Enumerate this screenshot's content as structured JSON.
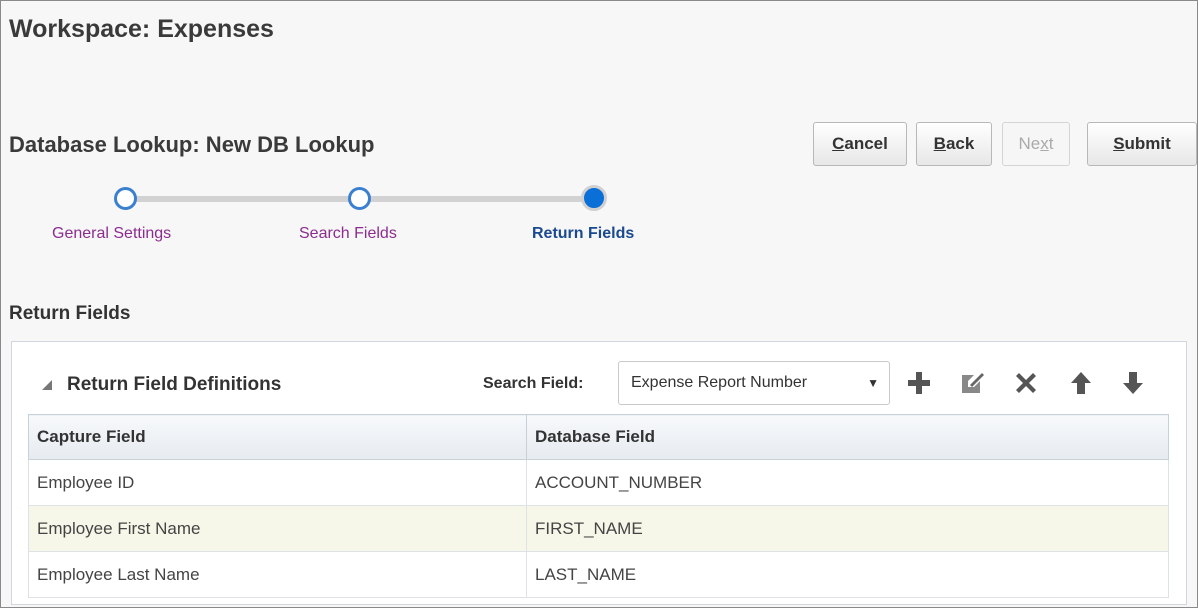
{
  "workspace_title": "Workspace: Expenses",
  "lookup_title": "Database Lookup: New DB Lookup",
  "buttons": {
    "cancel": {
      "pre": "",
      "mnemonic": "C",
      "post": "ancel"
    },
    "back": {
      "pre": "",
      "mnemonic": "B",
      "post": "ack"
    },
    "next": {
      "pre": "Ne",
      "mnemonic": "x",
      "post": "t"
    },
    "submit": {
      "pre": "",
      "mnemonic": "S",
      "post": "ubmit"
    }
  },
  "train": {
    "steps": [
      {
        "label": "General Settings",
        "state": "visited"
      },
      {
        "label": "Search Fields",
        "state": "visited"
      },
      {
        "label": "Return Fields",
        "state": "current"
      }
    ]
  },
  "section_title": "Return Fields",
  "panel": {
    "title": "Return Field Definitions",
    "search_label": "Search Field:",
    "search_value": "Expense Report Number",
    "toolbar_icons": [
      "add-icon",
      "edit-icon",
      "delete-icon",
      "move-up-icon",
      "move-down-icon"
    ]
  },
  "table": {
    "columns": [
      "Capture Field",
      "Database Field"
    ],
    "rows": [
      [
        "Employee ID",
        "ACCOUNT_NUMBER"
      ],
      [
        "Employee First Name",
        "FIRST_NAME"
      ],
      [
        "Employee Last Name",
        "LAST_NAME"
      ]
    ]
  },
  "colors": {
    "accent": "#0a6fd6",
    "visited_label": "#8b2c8f",
    "selected_row": "#f6f7e8"
  }
}
